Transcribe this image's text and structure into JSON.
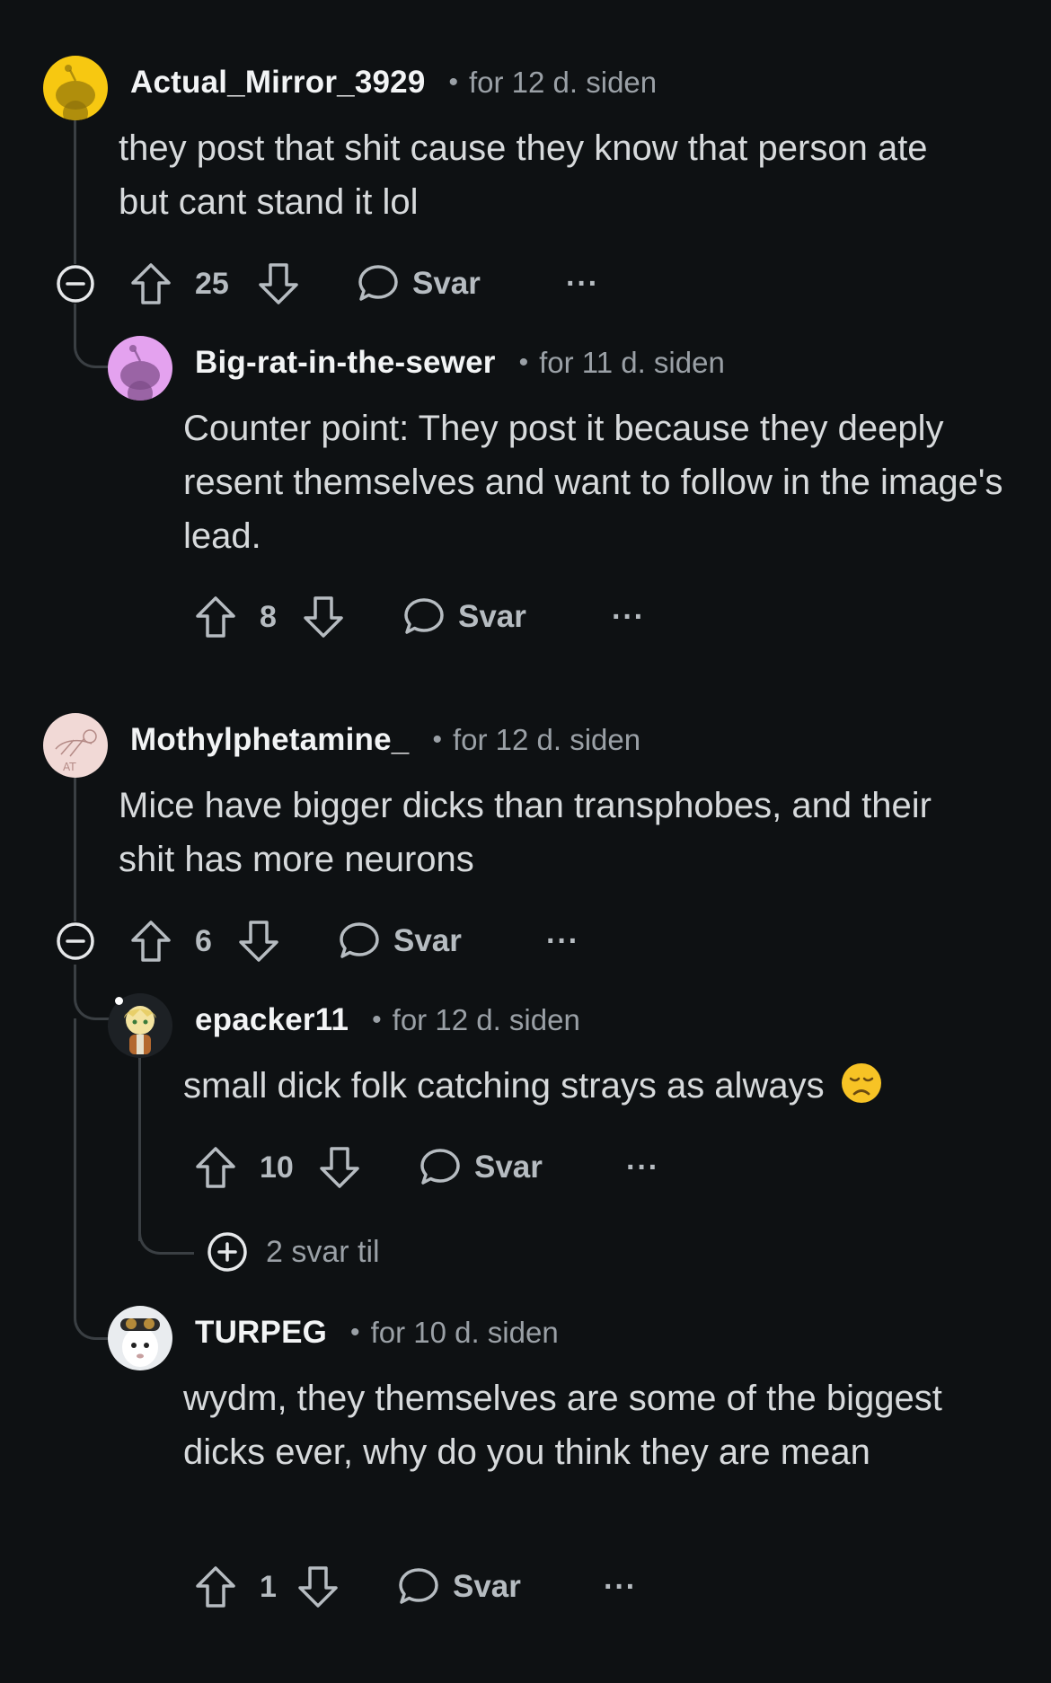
{
  "comments": [
    {
      "username": "Actual_Mirror_3929",
      "time": "for 12 d. siden",
      "text": "they post that shit cause they know that person ate but cant stand it lol",
      "votes": "25",
      "reply_label": "Svar",
      "more": "···",
      "avatar_color": "#f7c811",
      "replies": [
        {
          "username": "Big-rat-in-the-sewer",
          "time": "for 11 d. siden",
          "text": "Counter point: They post it because they deeply resent themselves and want to follow in the image's lead.",
          "votes": "8",
          "reply_label": "Svar",
          "more": "···",
          "avatar_color": "#e4a2ef"
        }
      ]
    },
    {
      "username": "Mothylphetamine_",
      "time": "for 12 d. siden",
      "text": "Mice have bigger dicks than transphobes, and their shit has more neurons",
      "votes": "6",
      "reply_label": "Svar",
      "more": "···",
      "avatar_color": "#f1d9d6",
      "replies": [
        {
          "username": "epacker11",
          "time": "for 12 d. siden",
          "text": "small dick folk catching strays as always",
          "emoji": "disappointed-face",
          "votes": "10",
          "reply_label": "Svar",
          "more": "···",
          "more_replies": "2 svar til"
        },
        {
          "username": "TURPEG",
          "time": "for 10 d. siden",
          "text": "wydm, they themselves are some of the biggest dicks ever, why do you think they are mean",
          "votes": "1",
          "reply_label": "Svar",
          "more": "···"
        }
      ]
    }
  ],
  "icons": {
    "upvote": "arrow-up-icon",
    "downvote": "arrow-down-icon",
    "reply": "speech-bubble-icon",
    "collapse": "minus-circle-icon",
    "expand": "plus-circle-icon"
  },
  "colors": {
    "background": "#0e1113",
    "text_primary": "#f2f4f5",
    "text_secondary": "#9aa0a6",
    "thread_line": "#3a3f43"
  }
}
